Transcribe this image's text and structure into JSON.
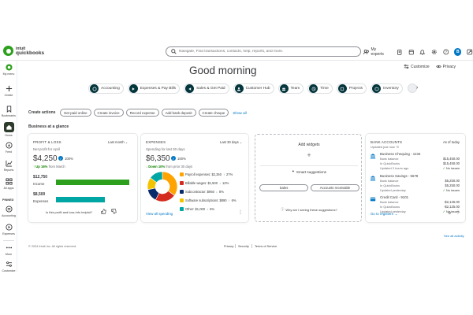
{
  "topbar": {
    "brand_top": "intuit",
    "brand_name": "quickbooks",
    "search_placeholder": "Navigate, Find transactions, contacts, help, reports, and more.",
    "my_experts": "My experts",
    "avatar_initial": "B"
  },
  "sidebar": {
    "items": [
      {
        "label": "My menu"
      },
      {
        "label": "Create"
      },
      {
        "label": "Bookmarks"
      },
      {
        "label": "Home"
      },
      {
        "label": "Feed"
      },
      {
        "label": "Reports"
      },
      {
        "label": "All apps"
      },
      {
        "label": "Accounting"
      },
      {
        "label": "Expenses"
      },
      {
        "label": "More"
      },
      {
        "label": "Customize"
      }
    ],
    "pinned_label": "PINNED"
  },
  "header": {
    "greeting": "Good morning",
    "customize": "Customize",
    "privacy": "Privacy"
  },
  "apps": [
    {
      "label": "Accounting"
    },
    {
      "label": "Expenses & Pay Bills"
    },
    {
      "label": "Sales & Get Paid"
    },
    {
      "label": "Customer Hub"
    },
    {
      "label": "Team"
    },
    {
      "label": "Time"
    },
    {
      "label": "Projects"
    },
    {
      "label": "Inventory"
    }
  ],
  "create_actions": {
    "label": "Create actions",
    "buttons": [
      "Get paid online",
      "Create invoice",
      "Record expense",
      "Add bank deposit",
      "Create cheque"
    ],
    "show_all": "Show all"
  },
  "business_glance": "Business at a glance",
  "profit_loss": {
    "title": "PROFIT & LOSS",
    "period": "Last month",
    "subtitle": "Net profit for April",
    "amount": "$4,250",
    "pct": "100%",
    "trend_dir": "Up 16%",
    "trend_rest": "from March",
    "income_amount": "$12,750",
    "income_label": "Income",
    "income_fraction": 1.0,
    "expenses_amount": "$8,500",
    "expenses_label": "Expenses",
    "expenses_fraction": 0.667,
    "helpful": "Is this profit and loss info helpful?"
  },
  "expenses_card": {
    "title": "EXPENSES",
    "period": "Last 30 days",
    "subtitle": "Spending for last 30 days",
    "amount": "$6,350",
    "pct": "100%",
    "trend_dir": "Down 10%",
    "trend_rest": "from prior 30 days",
    "view_all": "View all spending",
    "items": [
      {
        "label": "Payroll expenses: $2,350",
        "delta": "27%",
        "color": "#ffa300"
      },
      {
        "label": "Billable wages: $1,500",
        "delta": "12%",
        "color": "#d52b1e"
      },
      {
        "label": "Subcontractor: $950",
        "delta": "8%",
        "color": "#0a2b6b"
      },
      {
        "label": "Software subscriptions: $890",
        "delta": "6%",
        "color": "#f4c300"
      },
      {
        "label": "Other: $1,000",
        "delta": "6%",
        "color": "#00a6a4"
      }
    ],
    "chart_data": {
      "type": "pie",
      "categories": [
        "Payroll expenses",
        "Billable wages",
        "Subcontractor",
        "Software subscriptions",
        "Other"
      ],
      "values": [
        2350,
        1500,
        950,
        890,
        1000
      ]
    }
  },
  "add_widgets": {
    "title": "Add widgets",
    "suggestions": "Smart suggestions",
    "btn_sales": "Sales",
    "btn_ar": "Accounts receivable",
    "why": "Why am I seeing these suggestions?"
  },
  "bank": {
    "title": "BANK ACCOUNTS",
    "asof": "As of today",
    "updated": "Updated just now",
    "goto": "Go to registers",
    "accounts": [
      {
        "name": "Business Chequing - 1234",
        "bank_label": "Bank balance",
        "bank_val": "$15,450.00",
        "qb_label": "In QuickBooks",
        "qb_val": "$15,450.00",
        "updated": "Updated 3 hours ago",
        "status": "No issues"
      },
      {
        "name": "Business Savings - 5678",
        "bank_label": "Bank balance",
        "bank_val": "$5,250.00",
        "qb_label": "In QuickBooks",
        "qb_val": "$5,250.00",
        "updated": "Updated yesterday",
        "status": "No issues"
      },
      {
        "name": "Credit Card - 9101",
        "bank_label": "Bank balance",
        "bank_val": "-$2,125.00",
        "qb_label": "In QuickBooks",
        "qb_val": "-$2,125.00",
        "updated": "Updated yesterday",
        "status": "No issues"
      }
    ]
  },
  "see_all_activity": "See all activity",
  "footer": {
    "copyright": "© 2024 Intuit Inc. All rights reserved.",
    "privacy": "Privacy",
    "security": "Security",
    "terms": "Terms of Service"
  }
}
